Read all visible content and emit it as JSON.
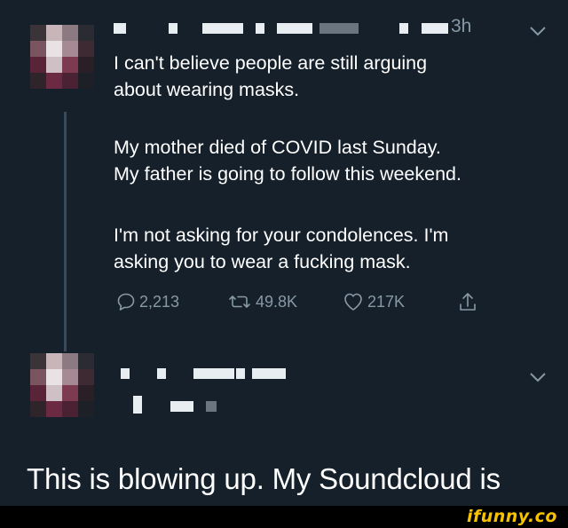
{
  "tweet1": {
    "time": "3h",
    "lines": [
      "I can't believe people are still arguing",
      "about wearing masks.",
      "My mother died of COVID last Sunday.",
      "My father is going to follow this weekend.",
      "I'm not asking for your condolences. I'm",
      "asking you to wear a fucking mask."
    ],
    "actions": {
      "replies": "2,213",
      "retweets": "49.8K",
      "likes": "217K"
    }
  },
  "caption": "This is blowing up. My Soundcloud is",
  "footer": {
    "watermark": "ifunny.co"
  },
  "colors": {
    "background": "#15202b",
    "text": "#ffffff",
    "secondary": "#8899a6",
    "watermark": "#f7c200"
  }
}
